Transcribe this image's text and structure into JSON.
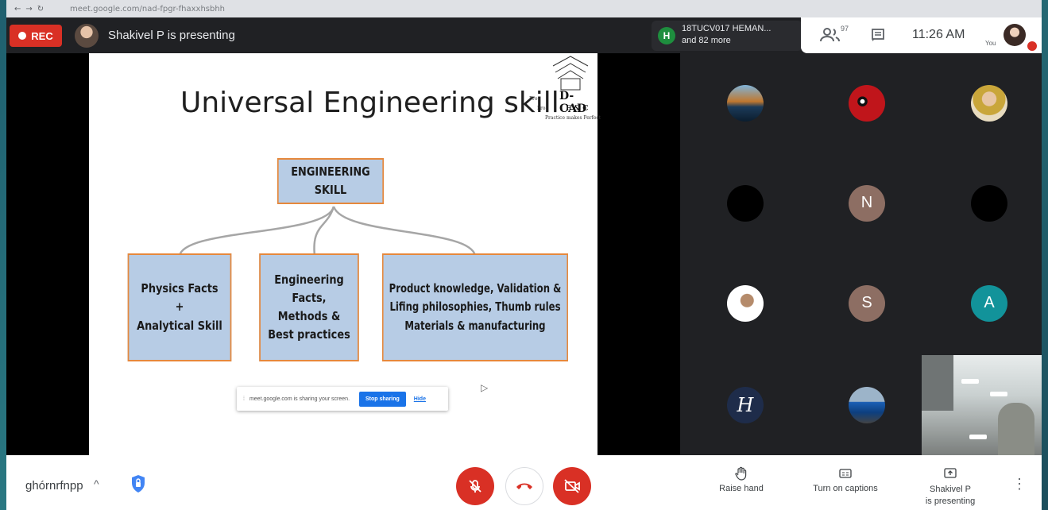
{
  "browser": {
    "url": "meet.google.com/nad-fpgr-fhaxxhsbhh"
  },
  "topbar": {
    "rec_label": "REC",
    "presenting_text": "Shakivel P is presenting",
    "participant_name": "18TUCV017 HEMAN...",
    "participant_more": "and 82 more",
    "participant_initial": "H",
    "people_count": "97",
    "time": "11:26 AM",
    "you_label": "You"
  },
  "slide": {
    "title": "Universal Engineering skill",
    "logo": {
      "line1": "Pro",
      "line2": "Pro",
      "brand": "D-CAD",
      "sub": "E & C",
      "tagline": "Practice makes Perfect"
    },
    "root_box": "ENGINEERING SKILL",
    "boxes": [
      "Physics Facts\n+\nAnalytical Skill",
      "Engineering Facts,\nMethods &\nBest practices",
      "Product knowledge, Validation &\nLifing philosophies, Thumb rules\nMaterials & manufacturing"
    ],
    "colors": {
      "box_fill": "#b7cce5",
      "box_border": "#e6883c"
    }
  },
  "share_bar": {
    "text": "meet.google.com is sharing your screen.",
    "stop_label": "Stop sharing",
    "hide_label": "Hide"
  },
  "grid": {
    "tiles": [
      {
        "type": "photo",
        "icon": "bridge-avatar"
      },
      {
        "type": "photo",
        "icon": "deadpool-avatar"
      },
      {
        "type": "photo",
        "icon": "person-avatar"
      },
      {
        "type": "blank",
        "color": "#000000"
      },
      {
        "type": "letter",
        "letter": "N",
        "color": "#8d6e63"
      },
      {
        "type": "blank",
        "color": "#000000"
      },
      {
        "type": "photo",
        "icon": "person-avatar"
      },
      {
        "type": "letter",
        "letter": "S",
        "color": "#8d6e63"
      },
      {
        "type": "letter",
        "letter": "A",
        "color": "#12939a"
      },
      {
        "type": "script",
        "letter": "H",
        "color": "#1e2c4a"
      },
      {
        "type": "photo",
        "icon": "car-avatar"
      }
    ]
  },
  "bottombar": {
    "meeting_code": "ghórnrfnpp",
    "raise_hand": "Raise hand",
    "captions": "Turn on captions",
    "present_line1": "Shakivel P",
    "present_line2": "is presenting",
    "colors": {
      "danger": "#d93025",
      "accent": "#1a73e8"
    }
  }
}
